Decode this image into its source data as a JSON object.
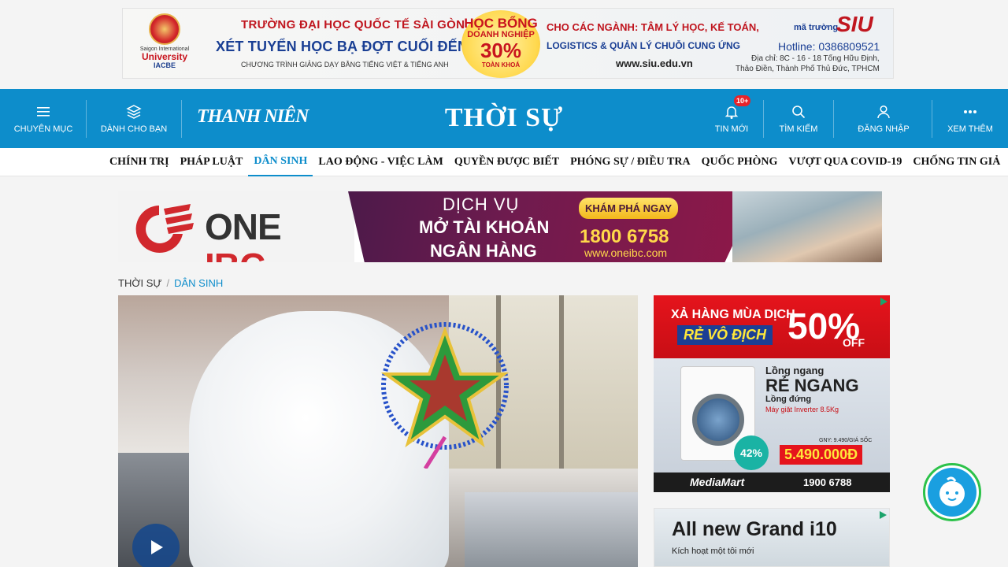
{
  "top_ad": {
    "logo_line1": "Saigon International",
    "logo_line2": "University",
    "logo_line3": "IACBE",
    "headline": "TRƯỜNG ĐẠI HỌC QUỐC TẾ SÀI GÒN",
    "subheadline": "XÉT TUYỂN HỌC BẠ ĐỢT CUỐI ĐẾN 30/9",
    "program": "CHƯƠNG TRÌNH GIẢNG DẠY BẰNG TIẾNG VIỆT & TIẾNG ANH",
    "scholar_1": "HỌC BỔNG",
    "scholar_2": "DOANH NGHIỆP",
    "scholar_3": "30%",
    "scholar_4": "TOÀN KHOÁ",
    "majors_1": "CHO CÁC NGÀNH: TÂM LÝ HỌC, KẾ TOÁN,",
    "majors_2": "LOGISTICS & QUẢN LÝ CHUỖI CUNG ỨNG",
    "website": "www.siu.edu.vn",
    "ma_truong": "mã trường",
    "code": "SIU",
    "hotline": "Hotline: 0386809521",
    "address_1": "Địa chỉ: 8C - 16 - 18 Tống Hữu Định,",
    "address_2": "Thảo Điền, Thành Phố Thủ Đức, TPHCM"
  },
  "header": {
    "menu_label": "CHUYÊN MỤC",
    "for_you_label": "DÀNH CHO BẠN",
    "brand": "THANH NIÊN",
    "section_title": "THỜI SỰ",
    "news_label": "TIN MỚI",
    "news_badge": "10+",
    "search_label": "TÌM KIẾM",
    "login_label": "ĐĂNG NHẬP",
    "more_label": "XEM THÊM"
  },
  "subnav": {
    "items": [
      {
        "label": "CHÍNH TRỊ"
      },
      {
        "label": "PHÁP LUẬT"
      },
      {
        "label": "DÂN SINH"
      },
      {
        "label": "LAO ĐỘNG - VIỆC LÀM"
      },
      {
        "label": "QUYỀN ĐƯỢC BIẾT"
      },
      {
        "label": "PHÓNG SỰ / ĐIỀU TRA"
      },
      {
        "label": "QUỐC PHÒNG"
      },
      {
        "label": "VƯỢT QUA COVID-19"
      },
      {
        "label": "CHỐNG TIN GIẢ"
      }
    ],
    "active_index": 2
  },
  "ad2": {
    "brand_one": "ONE",
    "brand_ibc": "IBC",
    "registered": "®",
    "line1": "DỊCH VỤ",
    "line2": "MỞ TÀI KHOẢN",
    "line3": "NGÂN HÀNG",
    "cta": "KHÁM PHÁ NGAY",
    "phone": "1800 6758",
    "website": "www.oneibc.com"
  },
  "breadcrumb": {
    "parent": "THỜI SỰ",
    "separator": "/",
    "current": "DÂN SINH"
  },
  "right_ad1": {
    "line1": "XẢ HÀNG MÙA DỊCH",
    "line2": "RẺ VÔ ĐỊCH",
    "percent": "50%",
    "off": "OFF",
    "product_1": "Lồng ngang",
    "product_2": "RẺ NGANG",
    "product_3": "Lồng đứng",
    "product_4": "Máy giặt Inverter 8.5Kg",
    "discount": "42%",
    "gny": "GNY: 9.490/GIÁ SỐC",
    "price": "5.490.000Đ",
    "store": "MediaMart",
    "hotline": "1900 6788"
  },
  "right_ad2": {
    "title": "All new Grand i10",
    "subtitle": "Kích hoạt một tôi mới"
  },
  "colors": {
    "header_blue": "#0d8dcb",
    "active_nav": "#0d8dcb",
    "badge_red": "#e8232a",
    "chatbot_border": "#2cc24a"
  }
}
